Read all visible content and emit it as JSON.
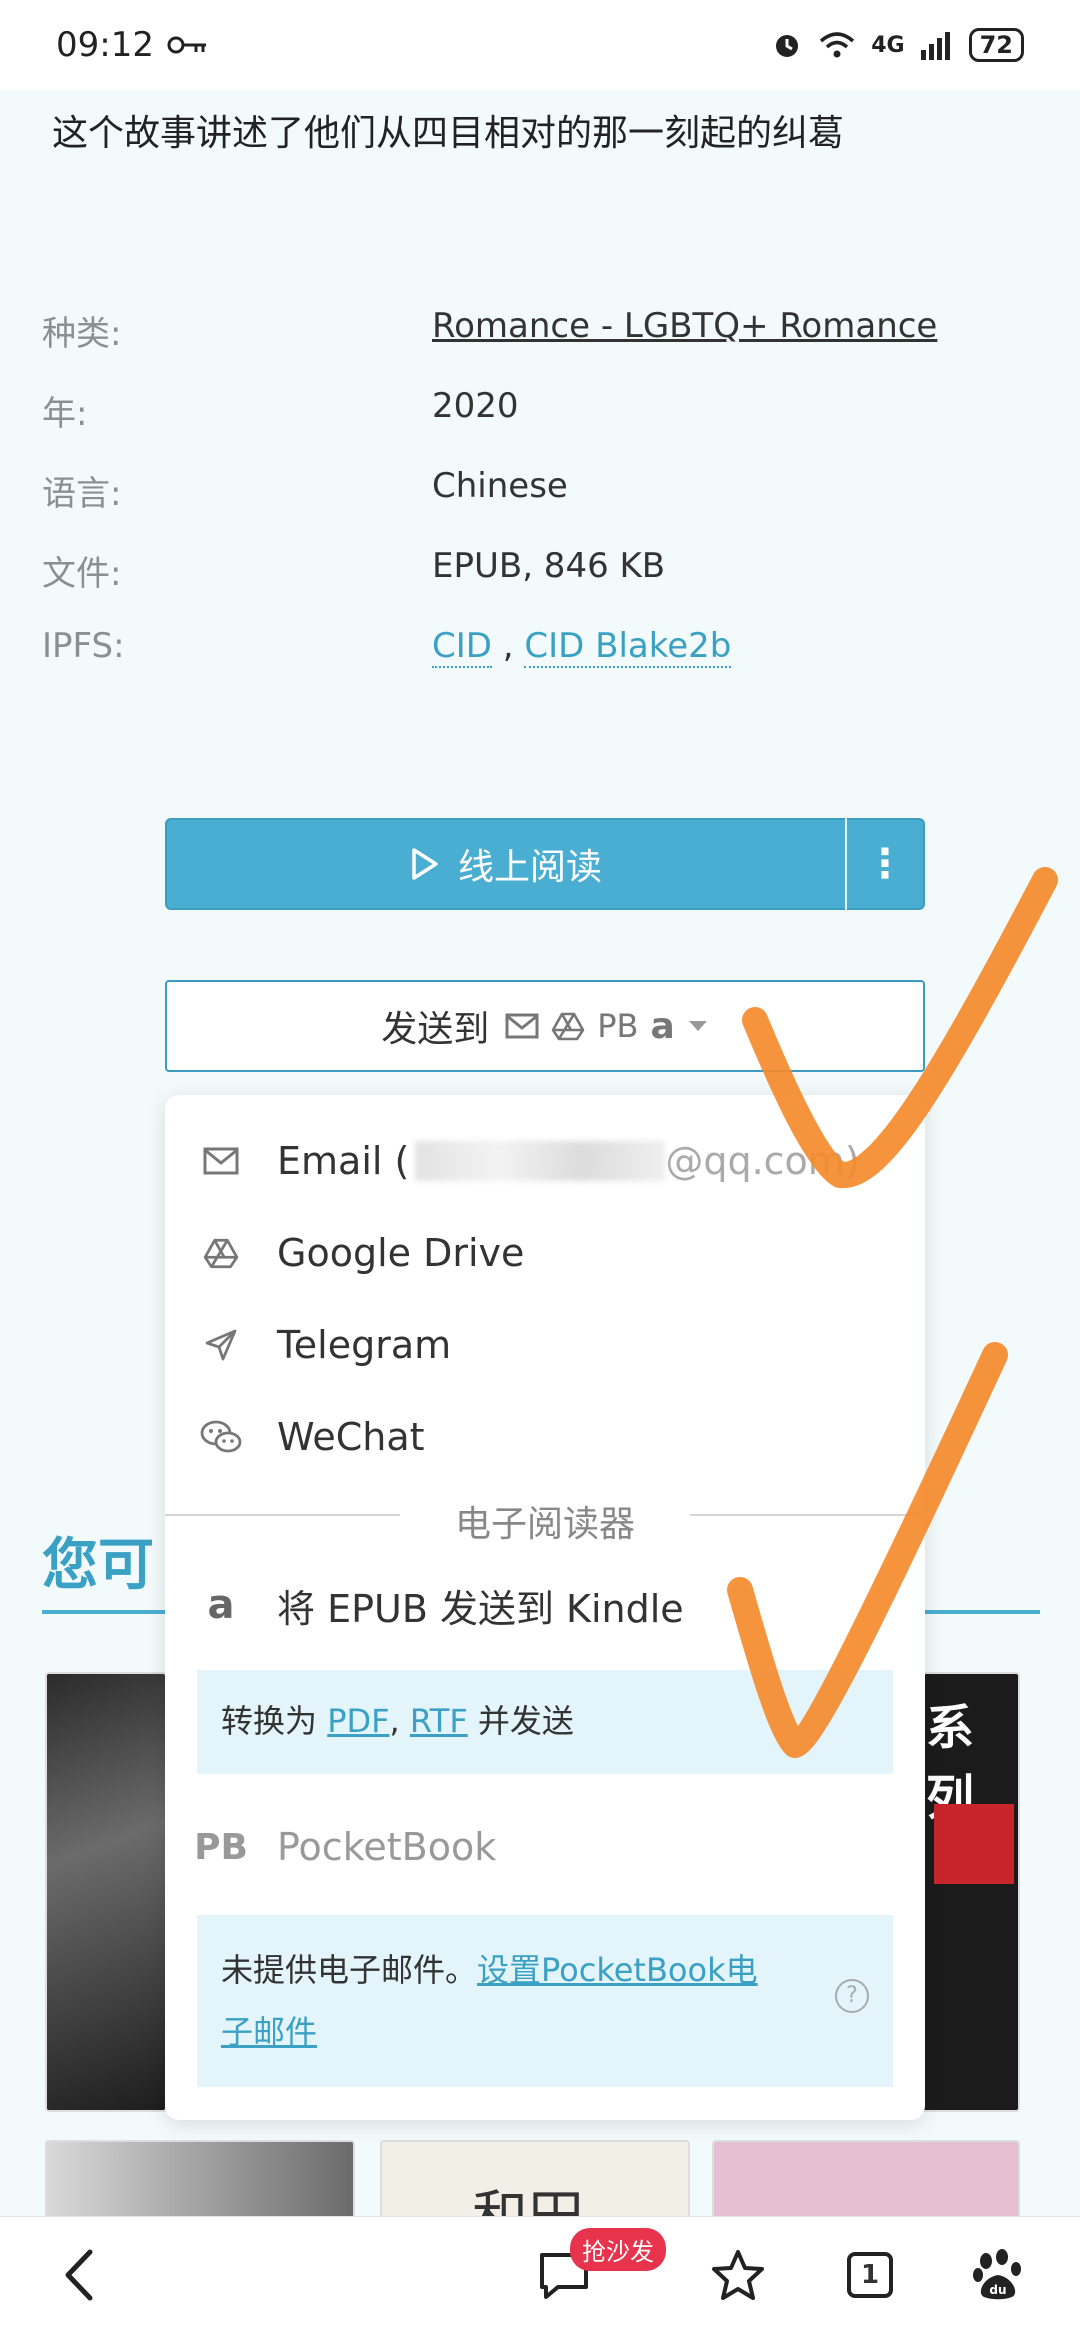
{
  "status_bar": {
    "time": "09:12",
    "battery": "72",
    "network": "4G"
  },
  "intro_text": "这个故事讲述了他们从四目相对的那一刻起的纠葛",
  "meta": {
    "category_label": "种类:",
    "category_value": "Romance - LGBTQ+ Romance",
    "year_label": "年:",
    "year_value": "2020",
    "language_label": "语言:",
    "language_value": "Chinese",
    "file_label": "文件:",
    "file_value": "EPUB, 846 KB",
    "ipfs_label": "IPFS:",
    "ipfs_cid": "CID",
    "ipfs_sep": ",",
    "ipfs_blake": "CID Blake2b"
  },
  "read_button": {
    "label": "线上阅读",
    "more": "⋮"
  },
  "send_button": {
    "label": "发送到",
    "pb": "PB",
    "amazon": "a"
  },
  "dropdown": {
    "email_label": "Email (",
    "email_tail": "@qq.com)",
    "google_drive": "Google Drive",
    "telegram": "Telegram",
    "wechat": "WeChat",
    "ereader_divider": "电子阅读器",
    "kindle": "将 EPUB 发送到 Kindle",
    "convert_prefix": "转换为 ",
    "convert_pdf": "PDF",
    "convert_comma": ", ",
    "convert_rtf": "RTF",
    "convert_suffix": " 并发送",
    "pb_icon": "PB",
    "pocketbook": "PocketBook",
    "no_email_text": "未提供电子邮件。",
    "setup_link": "设置PocketBook电子邮件",
    "help": "?"
  },
  "section": {
    "title": "您可",
    "cover_text_right": "系列",
    "cover_text_mid": "和田"
  },
  "bottom_nav": {
    "badge": "抢沙发",
    "tabs_count": "1"
  },
  "colors": {
    "accent": "#4aaed3",
    "link": "#3aa0c4",
    "annotation": "#f58a2c",
    "info_box": "#e3f4fb"
  }
}
